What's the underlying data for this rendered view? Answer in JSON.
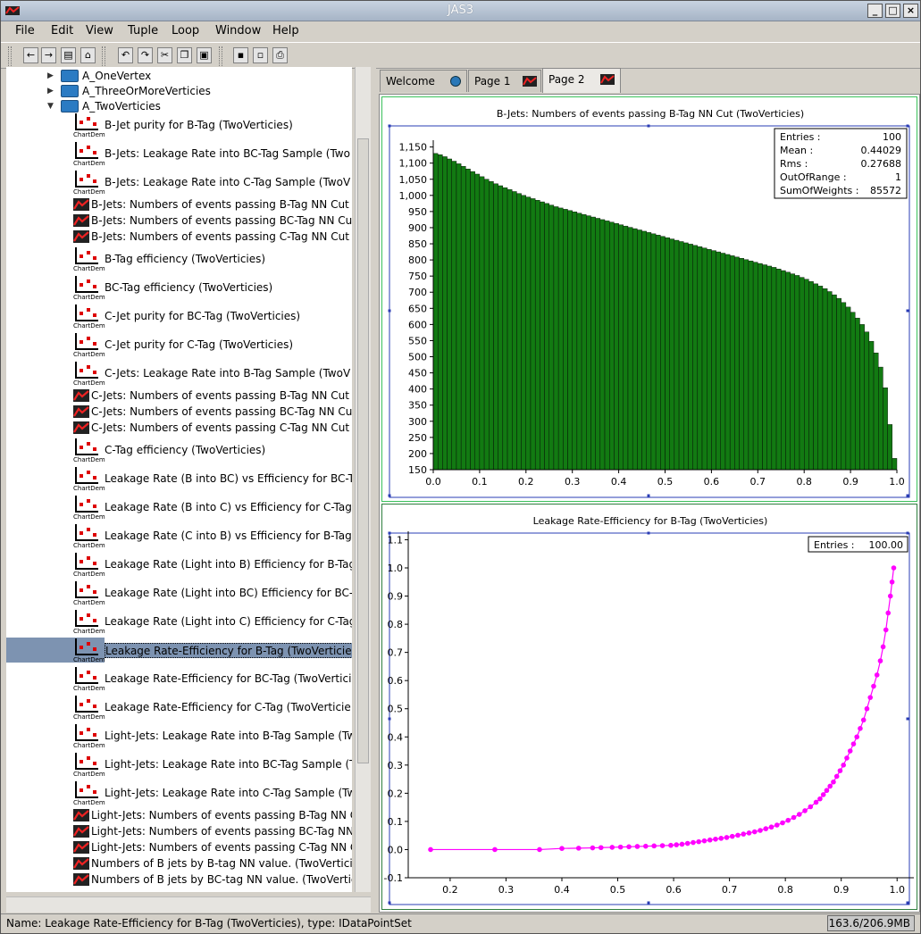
{
  "window": {
    "title": "JAS3"
  },
  "menu": [
    "File",
    "Edit",
    "View",
    "Tuple",
    "Loop",
    "Window",
    "Help"
  ],
  "tree": {
    "folders": [
      {
        "label": "A_OneVertex",
        "open": false
      },
      {
        "label": "A_ThreeOrMoreVerticies",
        "open": false
      },
      {
        "label": "A_TwoVerticies",
        "open": true
      }
    ],
    "chart_icon_label": "ChartDem",
    "items": [
      {
        "label": "B-Jet purity for B-Tag  (TwoVerticies)",
        "icon": "chart-icon"
      },
      {
        "label": "B-Jets: Leakage Rate into BC-Tag Sample  (Two",
        "icon": "chart-icon"
      },
      {
        "label": "B-Jets: Leakage Rate into C-Tag Sample  (TwoV",
        "icon": "chart-icon"
      },
      {
        "label": "B-Jets: Numbers of events passing B-Tag NN Cut",
        "icon": "histogram-icon"
      },
      {
        "label": "B-Jets: Numbers of events passing BC-Tag NN Cu",
        "icon": "histogram-icon"
      },
      {
        "label": "B-Jets: Numbers of events passing C-Tag NN Cut",
        "icon": "histogram-icon"
      },
      {
        "label": "B-Tag efficiency  (TwoVerticies)",
        "icon": "chart-icon"
      },
      {
        "label": "BC-Tag efficiency  (TwoVerticies)",
        "icon": "chart-icon"
      },
      {
        "label": "C-Jet purity for BC-Tag  (TwoVerticies)",
        "icon": "chart-icon"
      },
      {
        "label": "C-Jet purity for C-Tag  (TwoVerticies)",
        "icon": "chart-icon"
      },
      {
        "label": "C-Jets: Leakage Rate into B-Tag Sample  (TwoV",
        "icon": "chart-icon"
      },
      {
        "label": "C-Jets: Numbers of events passing B-Tag NN Cut",
        "icon": "histogram-icon"
      },
      {
        "label": "C-Jets: Numbers of events passing BC-Tag NN Cut",
        "icon": "histogram-icon"
      },
      {
        "label": "C-Jets: Numbers of events passing C-Tag NN Cut",
        "icon": "histogram-icon"
      },
      {
        "label": "C-Tag efficiency  (TwoVerticies)",
        "icon": "chart-icon"
      },
      {
        "label": "Leakage Rate (B into BC) vs Efficiency for BC-T",
        "icon": "chart-icon"
      },
      {
        "label": "Leakage Rate (B into C) vs Efficiency for C-Tag",
        "icon": "chart-icon"
      },
      {
        "label": "Leakage Rate (C into B) vs Efficiency for B-Tag",
        "icon": "chart-icon"
      },
      {
        "label": "Leakage Rate (Light into B) Efficiency for B-Tag",
        "icon": "chart-icon"
      },
      {
        "label": "Leakage Rate (Light into BC) Efficiency for BC-T",
        "icon": "chart-icon"
      },
      {
        "label": "Leakage Rate (Light into C) Efficiency for C-Tag",
        "icon": "chart-icon"
      },
      {
        "label": "Leakage Rate-Efficiency for B-Tag  (TwoVerticie",
        "icon": "chart-icon",
        "selected": true
      },
      {
        "label": "Leakage Rate-Efficiency for BC-Tag  (TwoVertici",
        "icon": "chart-icon"
      },
      {
        "label": "Leakage Rate-Efficiency for C-Tag  (TwoVerticie",
        "icon": "chart-icon"
      },
      {
        "label": "Light-Jets: Leakage Rate into B-Tag Sample  (Tw",
        "icon": "chart-icon"
      },
      {
        "label": "Light-Jets: Leakage Rate into BC-Tag Sample  (T",
        "icon": "chart-icon"
      },
      {
        "label": "Light-Jets: Leakage Rate into C-Tag Sample  (Tw",
        "icon": "chart-icon"
      },
      {
        "label": "Light-Jets: Numbers of events passing B-Tag NN C",
        "icon": "histogram-icon"
      },
      {
        "label": "Light-Jets: Numbers of events passing BC-Tag NN",
        "icon": "histogram-icon"
      },
      {
        "label": "Light-Jets: Numbers of events passing C-Tag NN C",
        "icon": "histogram-icon"
      },
      {
        "label": "Numbers of B jets by B-tag NN value. (TwoVerticie",
        "icon": "histogram-icon"
      },
      {
        "label": "Numbers of B jets by BC-tag NN value. (TwoVertic",
        "icon": "histogram-icon"
      }
    ]
  },
  "tabs": [
    {
      "label": "Welcome",
      "icon": "globe-icon",
      "active": false
    },
    {
      "label": "Page 1",
      "icon": "histogram-icon",
      "active": false
    },
    {
      "label": "Page 2",
      "icon": "histogram-icon",
      "active": true
    }
  ],
  "status": {
    "message": "Name: Leakage Rate-Efficiency for B-Tag  (TwoVerticies), type: IDataPointSet",
    "memory": "163.6/206.9MB"
  },
  "colors": {
    "histogram_fill": "#127a12",
    "scatter": "#ff00ff",
    "selection": "#7d93b1"
  },
  "chart_data": [
    {
      "type": "bar",
      "title": "B-Jets: Numbers of events passing B-Tag NN Cut  (TwoVerticies)",
      "xlim": [
        0.0,
        1.0
      ],
      "ylim": [
        150,
        1160
      ],
      "xticks": [
        "0.0",
        "0.1",
        "0.2",
        "0.3",
        "0.4",
        "0.5",
        "0.6",
        "0.7",
        "0.8",
        "0.9",
        "1.0"
      ],
      "yticks": [
        "150",
        "200",
        "250",
        "300",
        "350",
        "400",
        "450",
        "500",
        "550",
        "600",
        "650",
        "700",
        "750",
        "800",
        "850",
        "900",
        "950",
        "1,000",
        "1,050",
        "1,100",
        "1,150"
      ],
      "stats": [
        {
          "label": "Entries :",
          "value": "100"
        },
        {
          "label": "Mean :",
          "value": "0.44029"
        },
        {
          "label": "Rms :",
          "value": "0.27688"
        },
        {
          "label": "OutOfRange :",
          "value": "1"
        },
        {
          "label": "SumOfWeights :",
          "value": "85572"
        }
      ],
      "values": [
        1130,
        1126,
        1120,
        1113,
        1106,
        1098,
        1090,
        1082,
        1074,
        1066,
        1058,
        1050,
        1043,
        1036,
        1030,
        1024,
        1018,
        1012,
        1006,
        1000,
        995,
        990,
        985,
        980,
        975,
        970,
        965,
        961,
        957,
        953,
        949,
        945,
        941,
        937,
        933,
        929,
        925,
        921,
        917,
        913,
        909,
        905,
        901,
        897,
        893,
        889,
        885,
        881,
        877,
        873,
        869,
        865,
        861,
        857,
        853,
        849,
        845,
        841,
        837,
        833,
        829,
        825,
        821,
        817,
        813,
        809,
        805,
        801,
        797,
        793,
        789,
        785,
        781,
        777,
        772,
        767,
        762,
        757,
        752,
        746,
        740,
        733,
        726,
        719,
        711,
        702,
        692,
        681,
        668,
        654,
        638,
        620,
        600,
        577,
        548,
        512,
        468,
        404,
        290,
        185
      ]
    },
    {
      "type": "scatter",
      "title": "Leakage Rate-Efficiency for B-Tag  (TwoVerticies)",
      "xlim": [
        0.125,
        1.03
      ],
      "ylim": [
        -0.1,
        1.13
      ],
      "xticks": [
        "0.2",
        "0.3",
        "0.4",
        "0.5",
        "0.6",
        "0.7",
        "0.8",
        "0.9",
        "1.0"
      ],
      "yticks": [
        "-0.1",
        "0.0",
        "0.1",
        "0.2",
        "0.3",
        "0.4",
        "0.5",
        "0.6",
        "0.7",
        "0.8",
        "0.9",
        "1.0",
        "1.1"
      ],
      "legend": {
        "label": "Entries :",
        "value": "100.00"
      },
      "points": [
        [
          0.165,
          0.0
        ],
        [
          0.28,
          0.0
        ],
        [
          0.36,
          0.0
        ],
        [
          0.4,
          0.004
        ],
        [
          0.43,
          0.005
        ],
        [
          0.455,
          0.006
        ],
        [
          0.47,
          0.007
        ],
        [
          0.49,
          0.008
        ],
        [
          0.505,
          0.009
        ],
        [
          0.52,
          0.01
        ],
        [
          0.535,
          0.011
        ],
        [
          0.55,
          0.012
        ],
        [
          0.565,
          0.013
        ],
        [
          0.58,
          0.014
        ],
        [
          0.595,
          0.015
        ],
        [
          0.605,
          0.017
        ],
        [
          0.615,
          0.019
        ],
        [
          0.625,
          0.022
        ],
        [
          0.635,
          0.025
        ],
        [
          0.645,
          0.028
        ],
        [
          0.655,
          0.031
        ],
        [
          0.665,
          0.034
        ],
        [
          0.675,
          0.037
        ],
        [
          0.685,
          0.04
        ],
        [
          0.695,
          0.043
        ],
        [
          0.705,
          0.047
        ],
        [
          0.715,
          0.051
        ],
        [
          0.725,
          0.055
        ],
        [
          0.735,
          0.059
        ],
        [
          0.745,
          0.063
        ],
        [
          0.755,
          0.068
        ],
        [
          0.765,
          0.074
        ],
        [
          0.775,
          0.08
        ],
        [
          0.785,
          0.087
        ],
        [
          0.795,
          0.095
        ],
        [
          0.805,
          0.104
        ],
        [
          0.815,
          0.114
        ],
        [
          0.825,
          0.125
        ],
        [
          0.835,
          0.138
        ],
        [
          0.845,
          0.152
        ],
        [
          0.855,
          0.168
        ],
        [
          0.862,
          0.18
        ],
        [
          0.868,
          0.195
        ],
        [
          0.874,
          0.21
        ],
        [
          0.88,
          0.225
        ],
        [
          0.886,
          0.24
        ],
        [
          0.892,
          0.26
        ],
        [
          0.898,
          0.28
        ],
        [
          0.904,
          0.3
        ],
        [
          0.91,
          0.325
        ],
        [
          0.916,
          0.35
        ],
        [
          0.922,
          0.375
        ],
        [
          0.928,
          0.4
        ],
        [
          0.934,
          0.43
        ],
        [
          0.94,
          0.46
        ],
        [
          0.946,
          0.5
        ],
        [
          0.952,
          0.54
        ],
        [
          0.958,
          0.58
        ],
        [
          0.964,
          0.62
        ],
        [
          0.97,
          0.67
        ],
        [
          0.975,
          0.72
        ],
        [
          0.98,
          0.78
        ],
        [
          0.984,
          0.84
        ],
        [
          0.988,
          0.9
        ],
        [
          0.991,
          0.95
        ],
        [
          0.994,
          1.0
        ]
      ]
    }
  ]
}
